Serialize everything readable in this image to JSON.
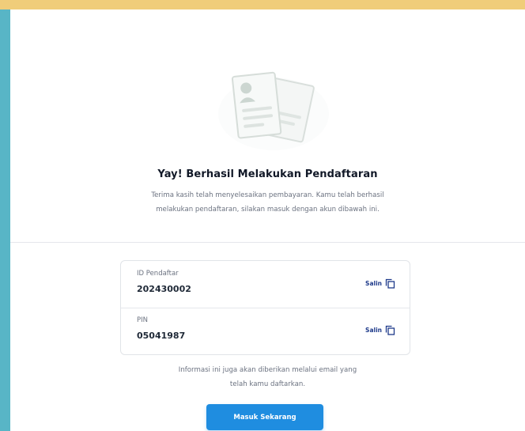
{
  "colors": {
    "top_band": "#f0cd7a",
    "left_strip": "#58b5c6",
    "primary": "#1f8de0"
  },
  "success": {
    "illustration_icon": "registration-documents-icon",
    "title": "Yay! Berhasil Melakukan Pendaftaran",
    "description_line1": "Terima kasih telah menyelesaikan pembayaran. Kamu telah berhasil",
    "description_line2": "melakukan pendaftaran, silakan masuk dengan akun dibawah ini."
  },
  "credentials": [
    {
      "label": "ID Pendaftar",
      "value": "202430002",
      "copy_label": "Salin"
    },
    {
      "label": "PIN",
      "value": "05041987",
      "copy_label": "Salin"
    }
  ],
  "info": {
    "line1": "Informasi ini juga akan diberikan melalui email yang",
    "line2": "telah kamu daftarkan."
  },
  "actions": {
    "login_label": "Masuk Sekarang"
  }
}
